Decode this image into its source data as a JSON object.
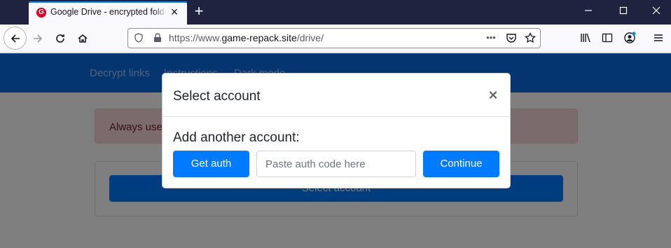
{
  "browser": {
    "tab_title": "Google Drive - encrypted folder",
    "tab_favicon": "G",
    "url_protocol": "https://www.",
    "url_host": "game-repack.site",
    "url_path": "/drive/"
  },
  "site_nav": {
    "links": [
      "Decrypt links",
      "Instructions",
      "Dark mode"
    ]
  },
  "page": {
    "alert_text": "Always use",
    "select_button_label": "Select account"
  },
  "modal": {
    "title": "Select account",
    "close_glyph": "×",
    "heading": "Add another account:",
    "get_auth_label": "Get auth",
    "auth_placeholder": "Paste auth code here",
    "continue_label": "Continue"
  },
  "colors": {
    "primary": "#007bff",
    "site_nav": "#0b6ae0",
    "alert_bg": "#f8d7da",
    "tabbar": "#202340"
  }
}
